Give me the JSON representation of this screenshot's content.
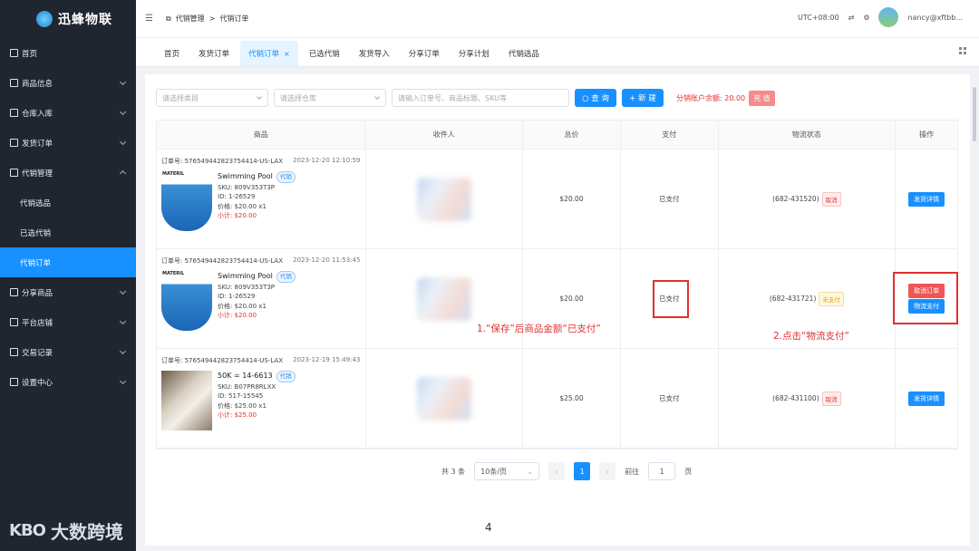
{
  "app": {
    "name": "迅蜂物联"
  },
  "sidebar": {
    "items": [
      {
        "label": "首页",
        "icon": "home-icon",
        "expandable": false
      },
      {
        "label": "商品信息",
        "icon": "box-icon",
        "expandable": true
      },
      {
        "label": "仓库入库",
        "icon": "warehouse-icon",
        "expandable": true
      },
      {
        "label": "发货订单",
        "icon": "list-icon",
        "expandable": true
      },
      {
        "label": "代销管理",
        "icon": "external-link-icon",
        "expandable": true,
        "expanded": true
      },
      {
        "label": "分享商品",
        "icon": "share-icon",
        "expandable": true
      },
      {
        "label": "平台店铺",
        "icon": "store-icon",
        "expandable": true
      },
      {
        "label": "交易记录",
        "icon": "record-icon",
        "expandable": true
      },
      {
        "label": "设置中心",
        "icon": "gear-icon",
        "expandable": true
      }
    ],
    "subitems": [
      {
        "label": "代销选品",
        "active": false
      },
      {
        "label": "已选代销",
        "active": false
      },
      {
        "label": "代销订单",
        "active": true
      }
    ]
  },
  "watermark": {
    "logo": "KBO",
    "text": "大数跨境"
  },
  "topbar": {
    "breadcrumb": [
      "代销管理",
      ">",
      "代销订单"
    ],
    "timezone": "UTC+08:00",
    "user": "nancy@xftbb..."
  },
  "tabs": [
    {
      "label": "首页",
      "active": false
    },
    {
      "label": "发货订单",
      "active": false
    },
    {
      "label": "代销订单",
      "active": true,
      "closable": true,
      "close": "×"
    },
    {
      "label": "已选代销",
      "active": false
    },
    {
      "label": "发货导入",
      "active": false
    },
    {
      "label": "分享订单",
      "active": false
    },
    {
      "label": "分享计划",
      "active": false
    },
    {
      "label": "代销选品",
      "active": false
    }
  ],
  "filters": {
    "category_placeholder": "请选择类目",
    "warehouse_placeholder": "请选择仓库",
    "search_placeholder": "请输入订单号、商品标题、SKU等",
    "query_label": "○ 查 询",
    "new_label": "+ 新 建",
    "balance_label": "分销账户余额: 20.00",
    "view_label": "充 值"
  },
  "table": {
    "headers": [
      "商品",
      "收件人",
      "总价",
      "支付",
      "物流状态",
      "操作"
    ],
    "rows": [
      {
        "order_no": "订单号: 576549442823754414-US-LAX",
        "time": "2023-12-20 12:10:59",
        "product_name": "Swimming Pool",
        "tag": "代销",
        "brand": "MATERIL",
        "sku": "SKU: 809V353T3P",
        "id": "ID: 1-26529",
        "price": "价格: $20.00 x1",
        "subtotal": "小计: $20.00",
        "total": "$20.00",
        "payment": "已支付",
        "logistics": "(682-431520)",
        "logistics_status": "取消",
        "logistics_status_type": "cancel",
        "actions": [
          "发货详情"
        ]
      },
      {
        "order_no": "订单号: 576549442823754414-US-LAX",
        "time": "2023-12-20 11:53:45",
        "product_name": "Swimming Pool",
        "tag": "代销",
        "brand": "MATERIL",
        "sku": "SKU: 809V353T3P",
        "id": "ID: 1-26529",
        "price": "价格: $20.00 x1",
        "subtotal": "小计: $20.00",
        "total": "$20.00",
        "payment": "已支付",
        "logistics": "(682-431721)",
        "logistics_status": "未支付",
        "logistics_status_type": "unpaid",
        "actions": [
          "取消订单",
          "物流支付"
        ]
      },
      {
        "order_no": "订单号: 576549442823754414-US-LAX",
        "time": "2023-12-19 15:49:43",
        "product_name": "50K = 14-6613",
        "tag": "代销",
        "brand": "",
        "sku": "SKU: B07PR8RLXX",
        "id": "ID: 517-15545",
        "price": "价格: $25.00 x1",
        "subtotal": "小计: $25.00",
        "total": "$25.00",
        "payment": "已支付",
        "logistics": "(682-431100)",
        "logistics_status": "取消",
        "logistics_status_type": "cancel",
        "actions": [
          "发货详情"
        ]
      }
    ]
  },
  "annotations": {
    "note1": "1.“保存”后商品金额“已支付”",
    "note2": "2.点击“物流支付”"
  },
  "pagination": {
    "total": "共 3 条",
    "page_size": "10条/页",
    "prev": "‹",
    "current": "1",
    "next": "›",
    "goto_label": "前往",
    "goto_value": "1",
    "page_unit": "页"
  },
  "page_number": "4",
  "colors": {
    "primary": "#1890ff",
    "danger": "#e03131",
    "sidebar_bg": "#1f2630"
  }
}
